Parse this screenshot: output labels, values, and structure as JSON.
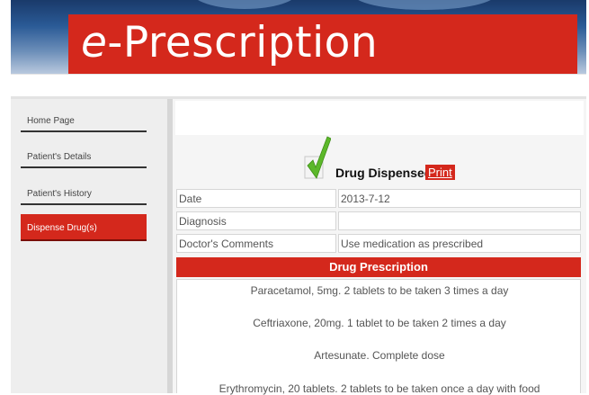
{
  "banner": {
    "title_prefix": "e",
    "title_rest": "-Prescription"
  },
  "sidebar": {
    "items": [
      {
        "label": "Home Page",
        "active": false
      },
      {
        "label": "Patient's Details",
        "active": false
      },
      {
        "label": "Patient's History",
        "active": false
      },
      {
        "label": "Dispense Drug(s)",
        "active": true
      }
    ]
  },
  "dispense": {
    "status": "Drug Dispensed",
    "print_label": "Print"
  },
  "details": [
    {
      "label": "Date",
      "value": "2013-7-12"
    },
    {
      "label": "Diagnosis",
      "value": ""
    },
    {
      "label": "Doctor's Comments",
      "value": "Use medication as prescribed"
    }
  ],
  "prescription": {
    "header": "Drug Prescription",
    "lines": [
      "Paracetamol, 5mg. 2 tablets to be taken 3 times a day",
      "Ceftriaxone, 20mg. 1 tablet to be taken 2 times a day",
      "Artesunate. Complete dose",
      "Erythromycin, 20 tablets. 2 tablets to be taken once a day with food"
    ]
  },
  "colors": {
    "accent_red": "#d4281c",
    "check_green": "#5cb82a"
  },
  "icons": {
    "checkmark": "checkmark-icon"
  }
}
